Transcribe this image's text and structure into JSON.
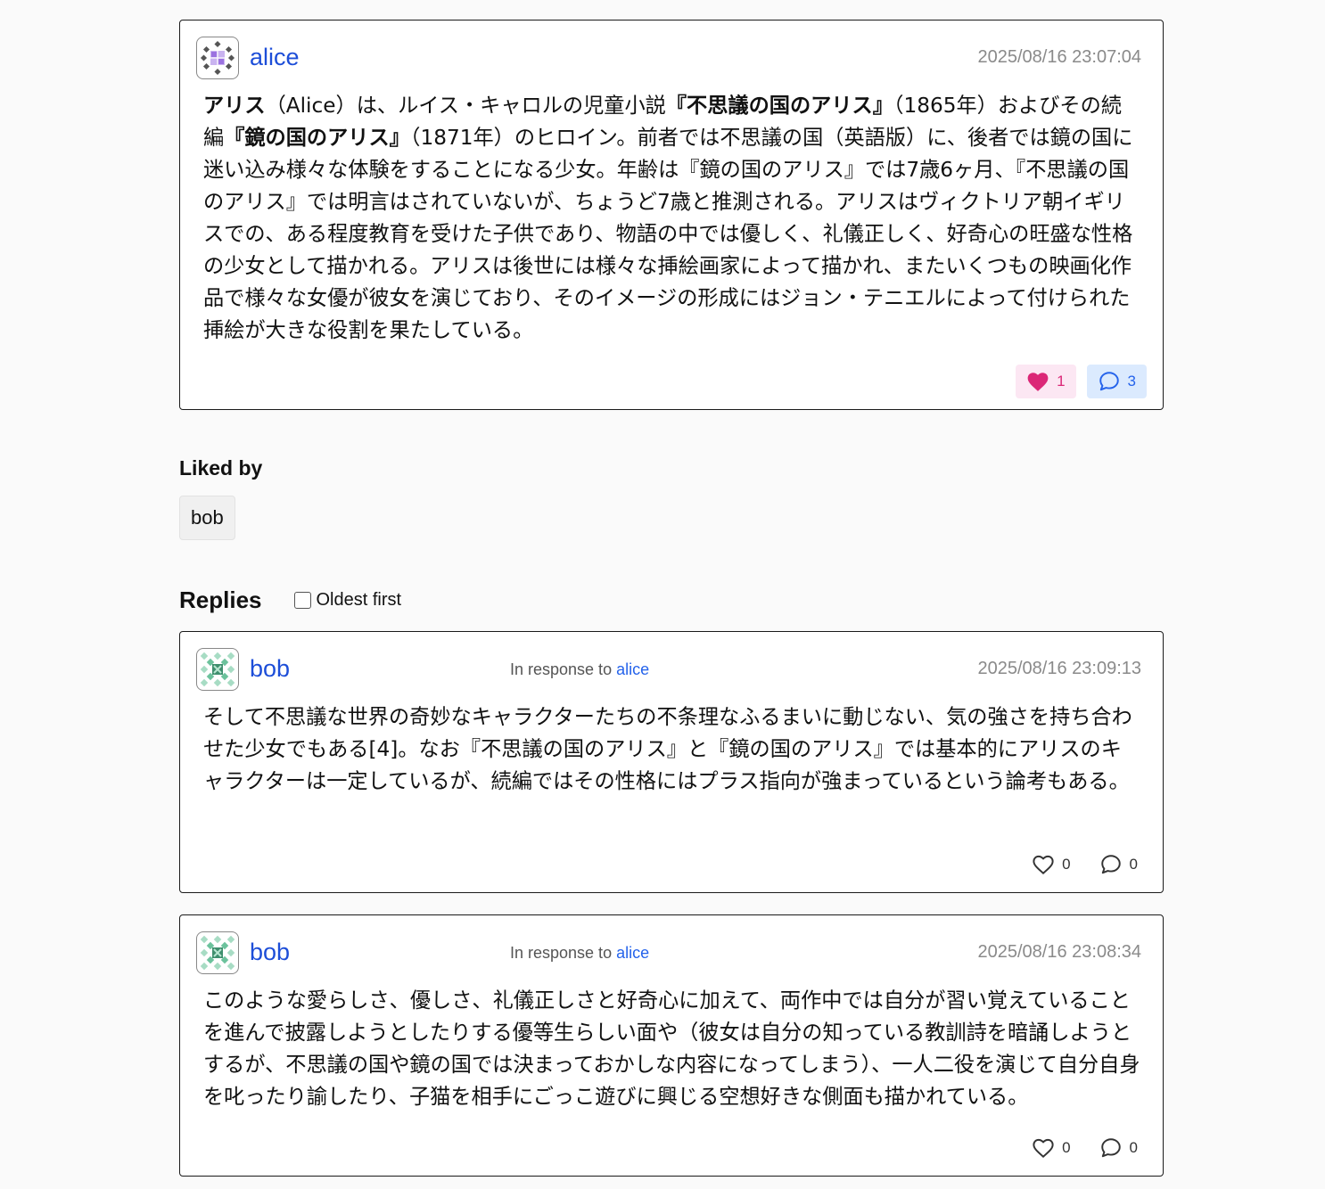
{
  "post": {
    "author": "alice",
    "timestamp": "2025/08/16 23:07:04",
    "body_html": "<b>アリス</b>（Alice）は、ルイス・キャロルの児童小説<b>『不思議の国のアリス』</b>（1865年）およびその続編<b>『鏡の国のアリス』</b>（1871年）のヒロイン。前者では不思議の国（英語版）に、後者では鏡の国に迷い込み様々な体験をすることになる少女。年齢は『鏡の国のアリス』では7歳6ヶ月、『不思議の国のアリス』では明言はされていないが、ちょうど7歳と推測される。アリスはヴィクトリア朝イギリスでの、ある程度教育を受けた子供であり、物語の中では優しく、礼儀正しく、好奇心の旺盛な性格の少女として描かれる。アリスは後世には様々な挿絵画家によって描かれ、またいくつもの映画化作品で様々な女優が彼女を演じており、そのイメージの形成にはジョン・テニエルによって付けられた挿絵が大きな役割を果たしている。",
    "likes": "1",
    "replies": "3"
  },
  "liked_by": {
    "title": "Liked by",
    "users": [
      "bob"
    ]
  },
  "replies_section": {
    "title": "Replies",
    "oldest_first_label": "Oldest first",
    "oldest_first_checked": false
  },
  "replies": [
    {
      "author": "bob",
      "in_response_prefix": "In response to",
      "in_response_to": "alice",
      "timestamp": "2025/08/16 23:09:13",
      "body": "そして不思議な世界の奇妙なキャラクターたちの不条理なふるまいに動じない、気の強さを持ち合わせた少女でもある[4]。なお『不思議の国のアリス』と『鏡の国のアリス』では基本的にアリスのキャラクターは一定しているが、続編ではその性格にはプラス指向が強まっているという論考もある。",
      "likes": "0",
      "replies": "0"
    },
    {
      "author": "bob",
      "in_response_prefix": "In response to",
      "in_response_to": "alice",
      "timestamp": "2025/08/16 23:08:34",
      "body": "このような愛らしさ、優しさ、礼儀正しさと好奇心に加えて、両作中では自分が習い覚えていることを進んで披露しようとしたりする優等生らしい面や（彼女は自分の知っている教訓詩を暗誦しようとするが、不思議の国や鏡の国では決まっておかしな内容になってしまう）、一人二役を演じて自分自身を叱ったり諭したり、子猫を相手にごっこ遊びに興じる空想好きな側面も描かれている。",
      "likes": "0",
      "replies": "0"
    }
  ],
  "colors": {
    "link": "#1d4ed8",
    "like_active_bg": "#fce7f3",
    "like_active_fg": "#db2777",
    "reply_active_bg": "#dbeafe",
    "reply_active_fg": "#2563eb"
  },
  "icons": [
    "identicon-avatar-icon",
    "heart-icon",
    "heart-outline-icon",
    "speech-bubble-icon"
  ]
}
